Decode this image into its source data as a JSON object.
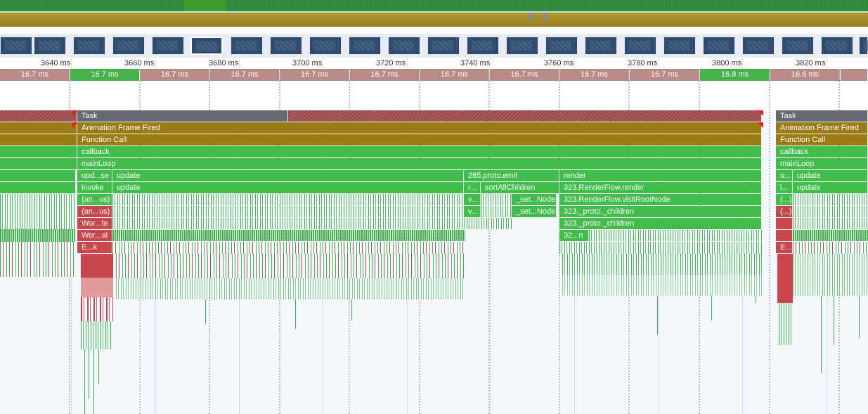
{
  "ruler": {
    "ticks": [
      "3640 ms",
      "3660 ms",
      "3680 ms",
      "3700 ms",
      "3720 ms",
      "3740 ms",
      "3760 ms",
      "3780 ms",
      "3800 ms",
      "3820 ms"
    ]
  },
  "frames": [
    {
      "label": "16.7 ms",
      "state": "idle"
    },
    {
      "label": "16.7 ms",
      "state": "good"
    },
    {
      "label": "16.7 ms",
      "state": "idle"
    },
    {
      "label": "16.7 ms",
      "state": "idle"
    },
    {
      "label": "16.7 ms",
      "state": "idle"
    },
    {
      "label": "16.7 ms",
      "state": "idle"
    },
    {
      "label": "16.7 ms",
      "state": "idle"
    },
    {
      "label": "16.7 ms",
      "state": "idle"
    },
    {
      "label": "16.7 ms",
      "state": "idle"
    },
    {
      "label": "16.7 ms",
      "state": "idle"
    },
    {
      "label": "16.8 ms",
      "state": "good"
    },
    {
      "label": "16.6 ms",
      "state": "idle"
    }
  ],
  "flame": {
    "task": "Task",
    "animation_frame": "Animation Frame Fired",
    "function_call": "Function Call",
    "callback": "callback",
    "main_loop": "mainLoop",
    "row5": {
      "a": "upd...se",
      "b": "update",
      "c": "285.proto.emit",
      "d": "render"
    },
    "row6": {
      "a": "invoke",
      "b": "update",
      "c": "r...",
      "d": "sortAllChildren",
      "e": "323.RenderFlow.render"
    },
    "row7": {
      "a": "(an...us)",
      "b": "v...",
      "c": "_set...Node",
      "d": "323.RenderFlow.visitRootNode"
    },
    "row8": {
      "a": "(an...us)",
      "b": "v...",
      "c": "_set...Node",
      "d": "323._proto._children"
    },
    "row9": {
      "a": "Wor...te",
      "b": "323._proto._children"
    },
    "row10": {
      "a": "Wor...al",
      "b": "32...n"
    },
    "row11": {
      "a": "E...k"
    },
    "right": {
      "task": "Task",
      "animation_frame": "Animation Frame Fired",
      "function_call": "Function Call",
      "callback": "callback",
      "main_loop": "mainLoop",
      "r5a": "u...",
      "r5b": "update",
      "r6a": "i...",
      "r6b": "update",
      "r7a": "(...)",
      "r8a": "(...)",
      "r11a": "E..."
    }
  },
  "colors": {
    "scripting": "#42bc4b",
    "task": "#666a70",
    "event": "#9a7b14",
    "long_task": "#c9474c",
    "frame_idle": "#b98b87",
    "frame_good": "#47b24a"
  }
}
